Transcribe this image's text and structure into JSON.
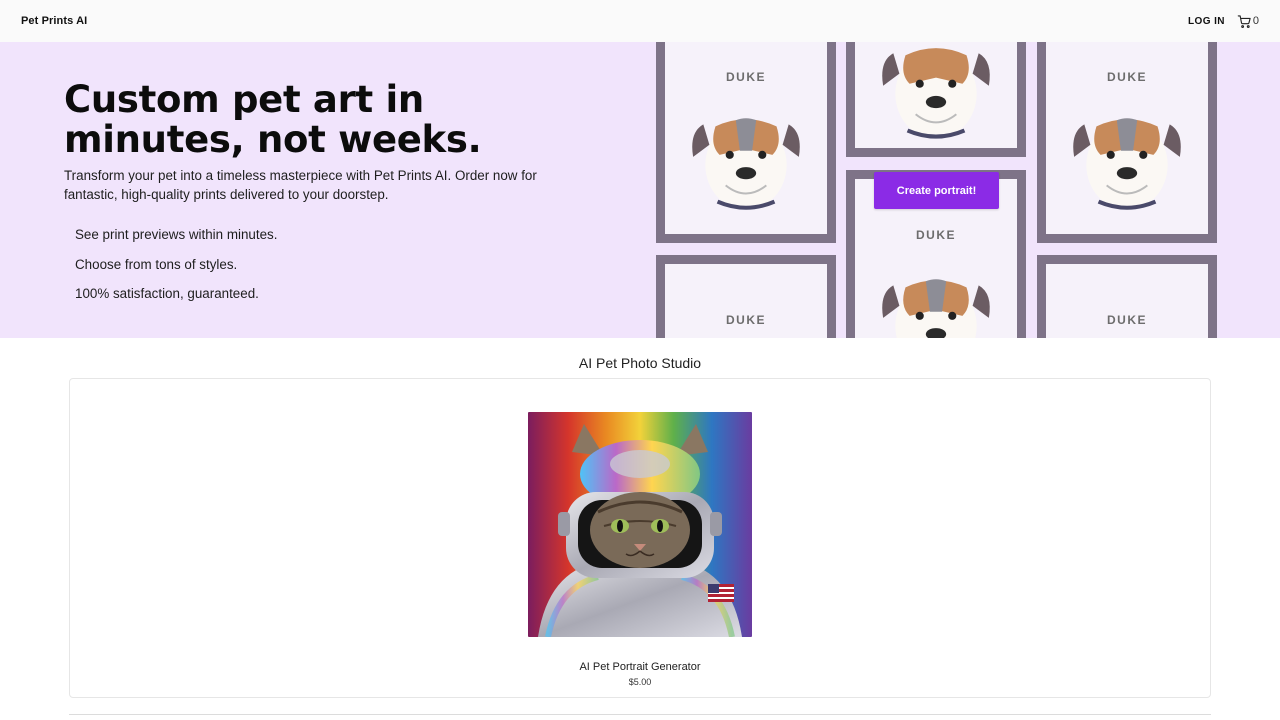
{
  "header": {
    "brand": "Pet Prints AI",
    "login_label": "LOG IN",
    "cart_count": "0",
    "cart_icon": "cart-icon"
  },
  "hero": {
    "headline": "Custom pet art in minutes, not weeks.",
    "subtext": "Transform your pet into a timeless masterpiece with Pet Prints AI. Order now for fantastic, high-quality prints delivered to your doorstep.",
    "bullets": [
      "See print previews within minutes.",
      "Choose from tons of styles.",
      "100% satisfaction, guaranteed."
    ],
    "cta_label": "Create portrait!",
    "portrait_name": "DUKE",
    "background_color": "#f1e4fc",
    "accent_color": "#8b2be6"
  },
  "studio": {
    "title": "AI Pet Photo Studio",
    "product": {
      "name": "AI Pet Portrait Generator",
      "price": "$5.00"
    }
  }
}
